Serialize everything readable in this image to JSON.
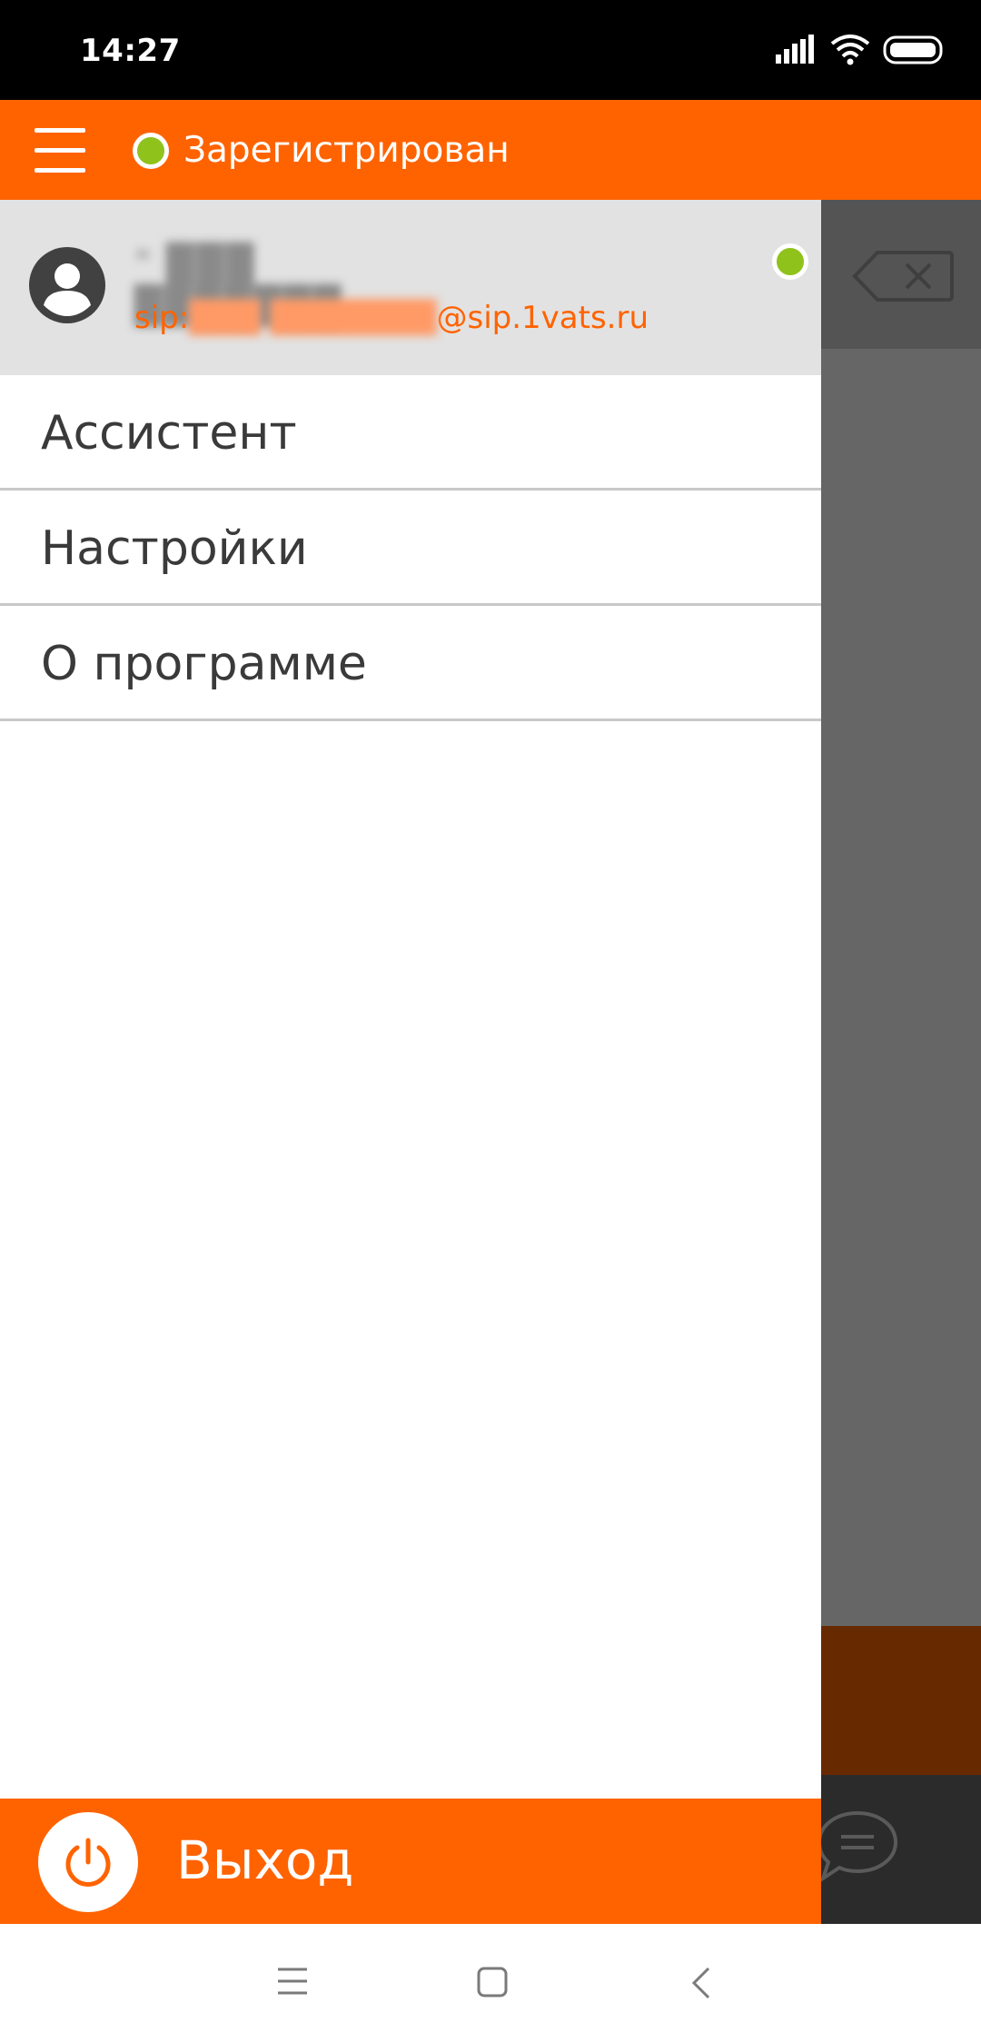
{
  "status_bar": {
    "time": "14:27",
    "icons": [
      "signal-icon",
      "wifi-icon",
      "battery-icon"
    ]
  },
  "app_bar": {
    "menu_icon": "hamburger-menu-icon",
    "registration_status": "Зарегистрирован",
    "status_color": "#8fc21b"
  },
  "drawer": {
    "header": {
      "avatar_icon": "user-avatar-icon",
      "user_name": "\" ███ ███████",
      "sip_prefix": "sip: ",
      "sip_masked": "███ ███████",
      "sip_domain": "@sip.1vats.ru",
      "online_color": "#8fc21b"
    },
    "menu_items": [
      {
        "label": "Ассистент"
      },
      {
        "label": "Настройки"
      },
      {
        "label": "О программе"
      }
    ],
    "exit": {
      "icon": "power-icon",
      "label": "Выход"
    }
  },
  "background": {
    "icons": [
      "backspace-icon",
      "chat-icon"
    ]
  },
  "nav_bar": {
    "icons": [
      "recent-apps-icon",
      "home-icon",
      "back-icon"
    ]
  },
  "colors": {
    "accent": "#ff6300",
    "online": "#8fc21b",
    "header_bg": "#e2e2e2"
  }
}
